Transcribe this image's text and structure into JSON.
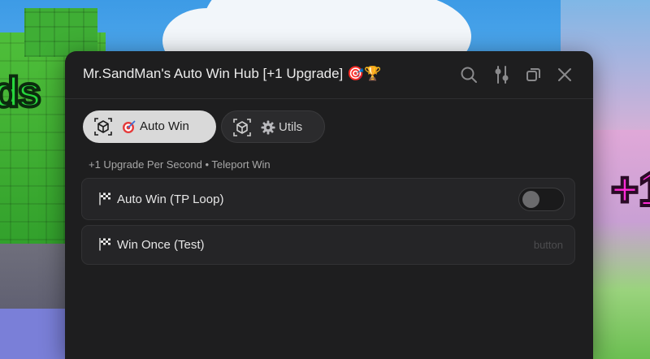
{
  "window": {
    "title": "Mr.SandMan's Auto Win Hub [+1 Upgrade]",
    "title_emoji": "🎯🏆"
  },
  "titlebar_icons": [
    "search-icon",
    "sliders-icon",
    "copy-icon",
    "close-icon"
  ],
  "tabs": [
    {
      "icon": "🎯",
      "label": "Auto Win",
      "active": true
    },
    {
      "icon": "⚙️",
      "label": "Utils",
      "active": false
    }
  ],
  "section": {
    "label": "+1 Upgrade Per Second • Teleport Win"
  },
  "rows": [
    {
      "icon": "🏁",
      "label": "Auto Win (TP Loop)",
      "type": "toggle",
      "enabled": false
    },
    {
      "icon": "🏁",
      "label": "Win Once (Test)",
      "type": "button",
      "hint": "button"
    }
  ],
  "background": {
    "left_text": "ds",
    "right_text": "+1"
  },
  "colors": {
    "window_bg": "#1e1e1f",
    "active_tab_bg": "#d9d9d9",
    "row_bg": "#252527",
    "text": "#e6e6e6"
  }
}
